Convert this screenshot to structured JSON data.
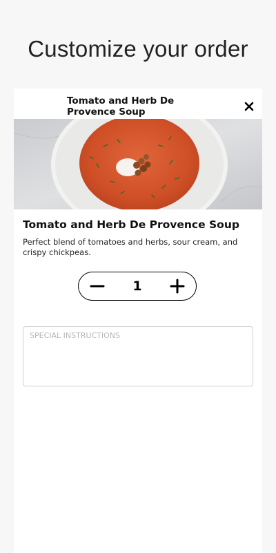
{
  "page": {
    "title": "Customize your order"
  },
  "modal": {
    "header_title": "Tomato and Herb De Provence Soup",
    "close_icon": "close-icon"
  },
  "item": {
    "name": "Tomato and Herb De Provence Soup",
    "description": "Perfect blend of tomatoes and herbs, sour cream, and crispy chickpeas.",
    "image_subject": "bowl of tomato soup with sour cream and crispy chickpeas"
  },
  "stepper": {
    "quantity": "1",
    "minus_icon": "minus-icon",
    "plus_icon": "plus-icon"
  },
  "instructions": {
    "value": "",
    "placeholder": "SPECIAL INSTRUCTIONS"
  },
  "colors": {
    "soup": "#d2552c",
    "bowl": "#f4f4f2",
    "background": "#f7f7f7"
  }
}
